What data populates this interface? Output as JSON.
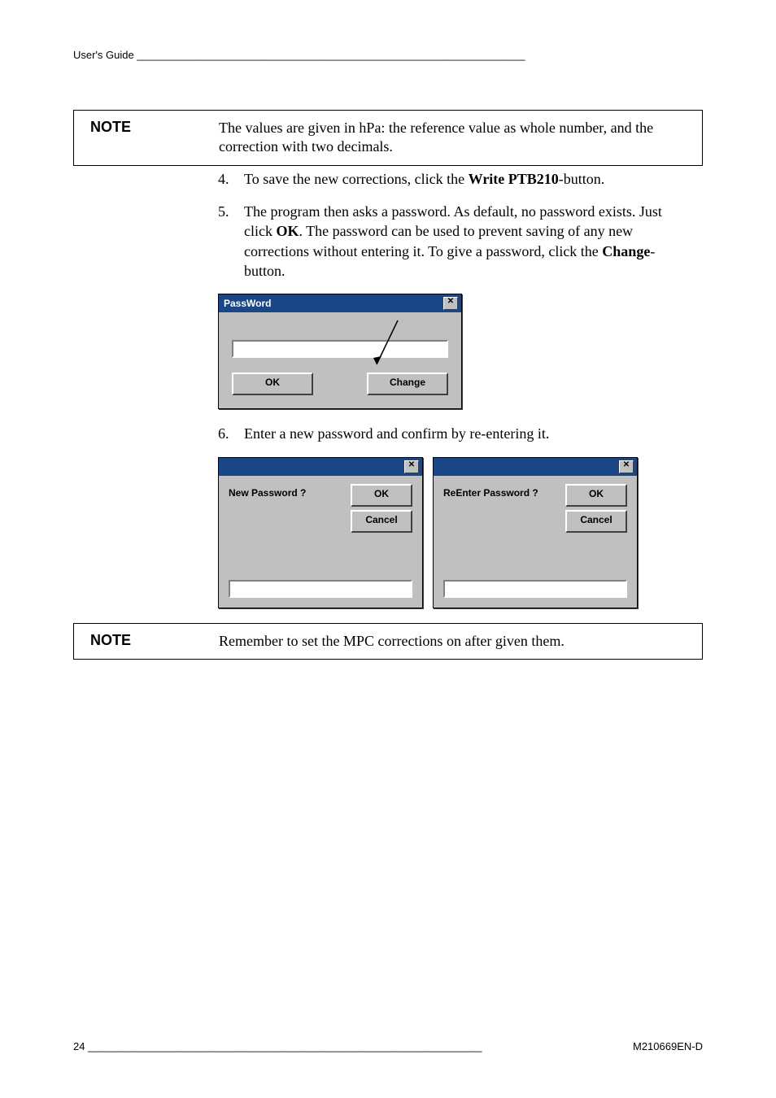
{
  "header": {
    "left": "User's Guide",
    "rule": "__________________________________________________________________"
  },
  "note1": {
    "label": "NOTE",
    "text": "The values are given in hPa: the reference value as whole number, and the correction with two decimals."
  },
  "steps": {
    "s4": {
      "num": "4.",
      "pre": "To save the new corrections, click the ",
      "bold": "Write PTB210",
      "post": "-button."
    },
    "s5": {
      "num": "5.",
      "pre": "The program then asks a password. As default, no password exists. Just click ",
      "bold1": "OK",
      "mid": ". The password can be used to prevent saving of any new corrections without entering it. To give a password, click the ",
      "bold2": "Change",
      "post": "-button."
    },
    "s6": {
      "num": "6.",
      "text": "Enter a new password and confirm by re-entering it."
    }
  },
  "dlg_password": {
    "title": "PassWord",
    "ok": "OK",
    "change": "Change"
  },
  "dlg_new": {
    "label": "New Password ?",
    "ok": "OK",
    "cancel": "Cancel"
  },
  "dlg_re": {
    "label": "ReEnter Password ?",
    "ok": "OK",
    "cancel": "Cancel"
  },
  "note2": {
    "label": "NOTE",
    "text": "Remember to set the MPC corrections on after given them."
  },
  "footer": {
    "page": "24",
    "rule": "___________________________________________________________________",
    "doc": "M210669EN-D"
  },
  "icons": {
    "close_glyph": "✕"
  }
}
